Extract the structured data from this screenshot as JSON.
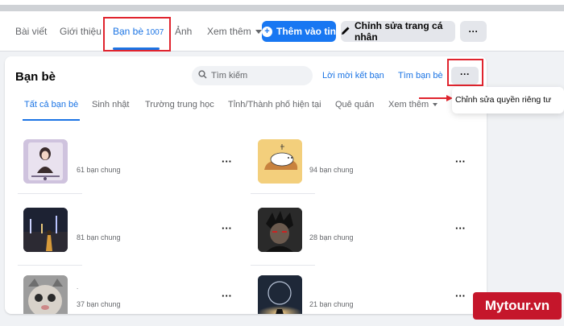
{
  "profile_tabs": {
    "posts": "Bài viết",
    "about": "Giới thiệu",
    "friends": "Bạn bè",
    "friends_count": "1007",
    "photos": "Ảnh",
    "see_more": "Xem thêm"
  },
  "actions": {
    "add_story": "Thêm vào tin",
    "edit_profile": "Chỉnh sửa trang cá nhân",
    "more": "···"
  },
  "friends_section": {
    "title": "Bạn bè",
    "search_placeholder": "Tìm kiếm",
    "friend_requests": "Lời mời kết bạn",
    "find_friends": "Tìm bạn bè",
    "more": "···"
  },
  "sub_tabs": [
    "Tất cả bạn bè",
    "Sinh nhật",
    "Trường trung học",
    "Tỉnh/Thành phố hiện tại",
    "Quê quán",
    "Xem thêm"
  ],
  "dropdown": {
    "privacy": "Chỉnh sửa quyền riêng tư"
  },
  "friends": [
    {
      "mutual": "61 bạn chung",
      "name": "",
      "thumb": "girl-poster"
    },
    {
      "mutual": "94 bạn chung",
      "name": "",
      "thumb": "cat-sticker"
    },
    {
      "mutual": "81 bạn chung",
      "name": "",
      "thumb": "night-city"
    },
    {
      "mutual": "28 bạn chung",
      "name": "",
      "thumb": "anime-boy"
    },
    {
      "mutual": "37 bạn chung",
      "name": ".",
      "thumb": "cat-face"
    },
    {
      "mutual": "21 bạn chung",
      "name": "",
      "thumb": "light-bulb"
    }
  ],
  "item_more": "···",
  "watermark": "Mytour.vn",
  "colors": {
    "accent": "#1b74e4",
    "primary_button": "#1877f2",
    "highlight": "#e0242e",
    "watermark_bg": "#c5162b"
  }
}
